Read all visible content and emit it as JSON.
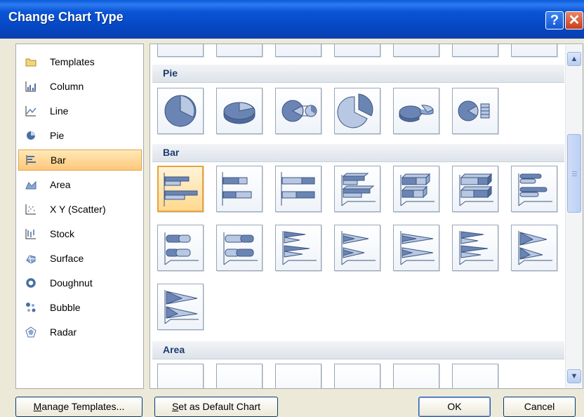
{
  "window": {
    "title": "Change Chart Type",
    "help_label": "?",
    "close_label": "✕"
  },
  "categories": [
    {
      "label": "Templates",
      "icon": "folder-icon"
    },
    {
      "label": "Column",
      "icon": "column-chart-icon"
    },
    {
      "label": "Line",
      "icon": "line-chart-icon"
    },
    {
      "label": "Pie",
      "icon": "pie-chart-icon"
    },
    {
      "label": "Bar",
      "icon": "bar-chart-icon",
      "selected": true
    },
    {
      "label": "Area",
      "icon": "area-chart-icon"
    },
    {
      "label": "X Y (Scatter)",
      "icon": "scatter-chart-icon"
    },
    {
      "label": "Stock",
      "icon": "stock-chart-icon"
    },
    {
      "label": "Surface",
      "icon": "surface-chart-icon"
    },
    {
      "label": "Doughnut",
      "icon": "doughnut-chart-icon"
    },
    {
      "label": "Bubble",
      "icon": "bubble-chart-icon"
    },
    {
      "label": "Radar",
      "icon": "radar-chart-icon"
    }
  ],
  "gallery": {
    "sections": [
      {
        "title": "Pie",
        "tiles": [
          "pie",
          "pie-3d",
          "pie-of-pie",
          "exploded-pie",
          "exploded-pie-3d",
          "bar-of-pie"
        ]
      },
      {
        "title": "Bar",
        "tiles": [
          "clustered-bar",
          "stacked-bar",
          "100-stacked-bar",
          "3d-clustered-bar",
          "3d-stacked-bar",
          "3d-100-stacked-bar",
          "clustered-cylinder-bar",
          "stacked-cylinder-bar",
          "100-stacked-cylinder-bar",
          "clustered-cone-bar",
          "stacked-cone-bar",
          "100-stacked-cone-bar",
          "clustered-pyramid-bar",
          "stacked-pyramid-bar",
          "100-stacked-pyramid-bar"
        ],
        "selected": "clustered-bar"
      },
      {
        "title": "Area",
        "tiles": []
      }
    ]
  },
  "buttons": {
    "manage_templates": "Manage Templates...",
    "set_default": "Set as Default Chart",
    "ok": "OK",
    "cancel": "Cancel"
  },
  "colors": {
    "title_bar": "#0a55d6",
    "selection": "#ffc77a",
    "tile_fill": "#6a85b4"
  }
}
